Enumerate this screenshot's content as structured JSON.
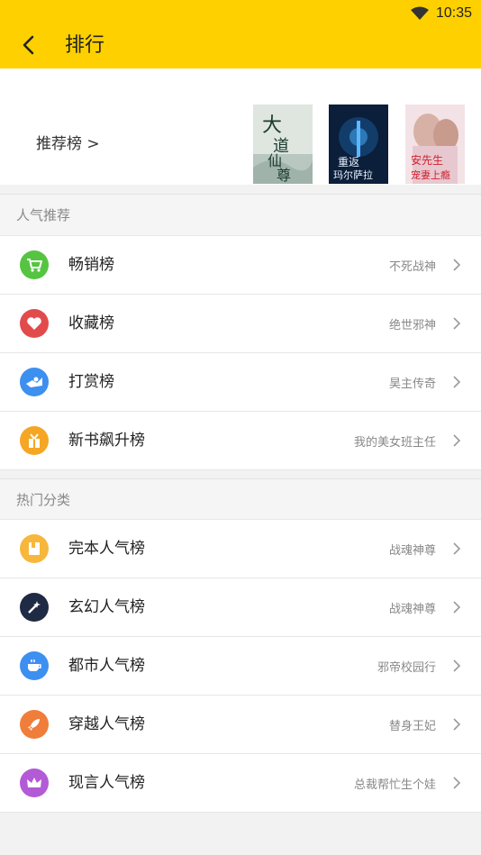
{
  "status": {
    "time": "10:35"
  },
  "header": {
    "title": "排行"
  },
  "recommend": {
    "label": "推荐榜 >",
    "covers": [
      {
        "title": "大道仙尊"
      },
      {
        "title": "重返玛尔萨拉"
      },
      {
        "title": "安先生宠妻上瘾"
      }
    ]
  },
  "section1": {
    "heading": "人气推荐",
    "rows": [
      {
        "name": "畅销榜",
        "hint": "不死战神",
        "icon": "cart-icon",
        "color": "#55c441"
      },
      {
        "name": "收藏榜",
        "hint": "绝世邪神",
        "icon": "heart-icon",
        "color": "#e24b4b"
      },
      {
        "name": "打赏榜",
        "hint": "昊主传奇",
        "icon": "reward-icon",
        "color": "#3d8ff0"
      },
      {
        "name": "新书飙升榜",
        "hint": "我的美女班主任",
        "icon": "gift-icon",
        "color": "#f5a623"
      }
    ]
  },
  "section2": {
    "heading": "热门分类",
    "rows": [
      {
        "name": "完本人气榜",
        "hint": "战魂神尊",
        "icon": "book-icon",
        "color": "#f7b73c"
      },
      {
        "name": "玄幻人气榜",
        "hint": "战魂神尊",
        "icon": "magic-wand-icon",
        "color": "#1f2a44"
      },
      {
        "name": "都市人气榜",
        "hint": "邪帝校园行",
        "icon": "coffee-icon",
        "color": "#3d8ff0"
      },
      {
        "name": "穿越人气榜",
        "hint": "替身王妃",
        "icon": "rocket-icon",
        "color": "#f07d3a"
      },
      {
        "name": "现言人气榜",
        "hint": "总裁帮忙生个娃",
        "icon": "crown-icon",
        "color": "#b35ad6"
      }
    ]
  }
}
